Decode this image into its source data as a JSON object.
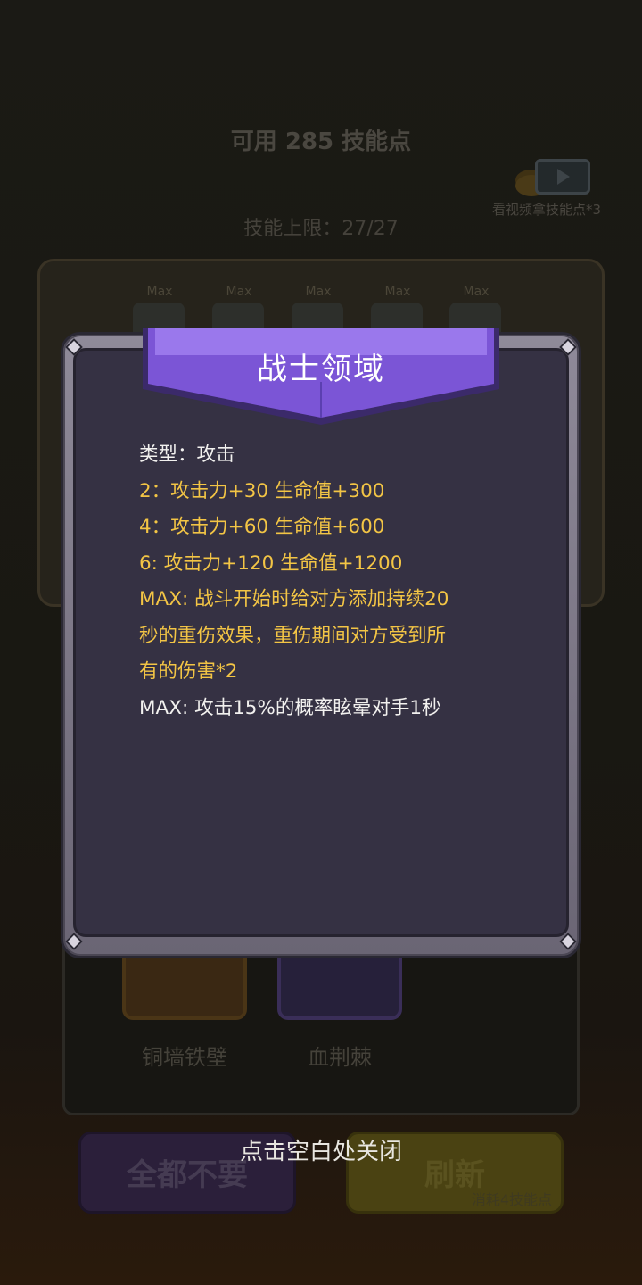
{
  "background": {
    "points_available": "可用 285 技能点",
    "video_bonus_label": "看视频拿技能点*3",
    "skill_limit": "技能上限：27/27",
    "book_slots": [
      {
        "tag": "Max"
      },
      {
        "tag": "Max"
      },
      {
        "tag": "Max"
      },
      {
        "tag": "Max"
      },
      {
        "tag": "Max"
      }
    ],
    "skill_cards": [
      {
        "name": "铜墙铁壁"
      },
      {
        "name": "血荆棘"
      }
    ],
    "buttons": {
      "skip_all": "全都不要",
      "refresh": "刷新",
      "refresh_cost": "消耗4技能点"
    }
  },
  "popup": {
    "title": "战士领域",
    "lines": [
      {
        "text": "类型：攻击",
        "color": "white"
      },
      {
        "text": "2：攻击力+30 生命值+300",
        "color": "gold"
      },
      {
        "text": "4：攻击力+60 生命值+600",
        "color": "gold"
      },
      {
        "text": "6: 攻击力+120 生命值+1200",
        "color": "gold"
      },
      {
        "text": "MAX: 战斗开始时给对方添加持续20",
        "color": "gold"
      },
      {
        "text": "秒的重伤效果，重伤期间对方受到所",
        "color": "gold"
      },
      {
        "text": "有的伤害*2",
        "color": "gold"
      },
      {
        "text": "MAX: 攻击15%的概率眩晕对手1秒",
        "color": "white"
      }
    ]
  },
  "close_hint": "点击空白处关闭",
  "colors": {
    "gold_text": "#f3c545",
    "white_text": "#f2f1ef",
    "banner_purple": "#7b55d6",
    "panel_bg": "#353143"
  }
}
